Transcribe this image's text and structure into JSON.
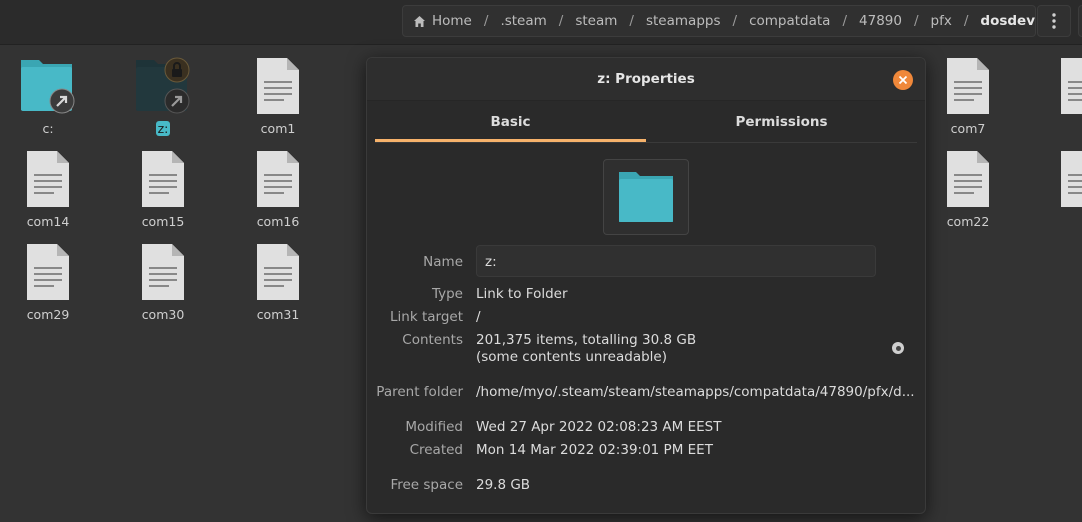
{
  "breadcrumb": {
    "items": [
      "Home",
      ".steam",
      "steam",
      "steamapps",
      "compatdata",
      "47890",
      "pfx",
      "dosdevices"
    ],
    "separator": "/"
  },
  "colors": {
    "folder": "#48b9c7",
    "accent": "#f6b26b",
    "close": "#f0883a"
  },
  "files": [
    {
      "label": "c:",
      "kind": "folder-link"
    },
    {
      "label": "z:",
      "kind": "folder-link-locked"
    },
    {
      "label": "com1",
      "kind": "text-file"
    },
    {
      "label": "com7",
      "kind": "text-file"
    },
    {
      "label": "com14",
      "kind": "text-file"
    },
    {
      "label": "com15",
      "kind": "text-file"
    },
    {
      "label": "com16",
      "kind": "text-file"
    },
    {
      "label": "com22",
      "kind": "text-file"
    },
    {
      "label": "com29",
      "kind": "text-file"
    },
    {
      "label": "com30",
      "kind": "text-file"
    },
    {
      "label": "com31",
      "kind": "text-file"
    }
  ],
  "dialog": {
    "title": "z: Properties",
    "tabs": [
      "Basic",
      "Permissions"
    ],
    "active_tab": "Basic",
    "name_label": "Name",
    "name_value": "z:",
    "type_label": "Type",
    "type_value": "Link to Folder",
    "link_target_label": "Link target",
    "link_target_value": "/",
    "contents_label": "Contents",
    "contents_line1": "201,375 items, totalling 30.8 GB",
    "contents_line2": "(some contents unreadable)",
    "parent_label": "Parent folder",
    "parent_value": "/home/myo/.steam/steam/steamapps/compatdata/47890/pfx/d...",
    "modified_label": "Modified",
    "modified_value": "Wed 27 Apr 2022 02:08:23 AM EEST",
    "created_label": "Created",
    "created_value": "Mon 14 Mar 2022 02:39:01 PM EET",
    "free_label": "Free space",
    "free_value": "29.8 GB"
  }
}
